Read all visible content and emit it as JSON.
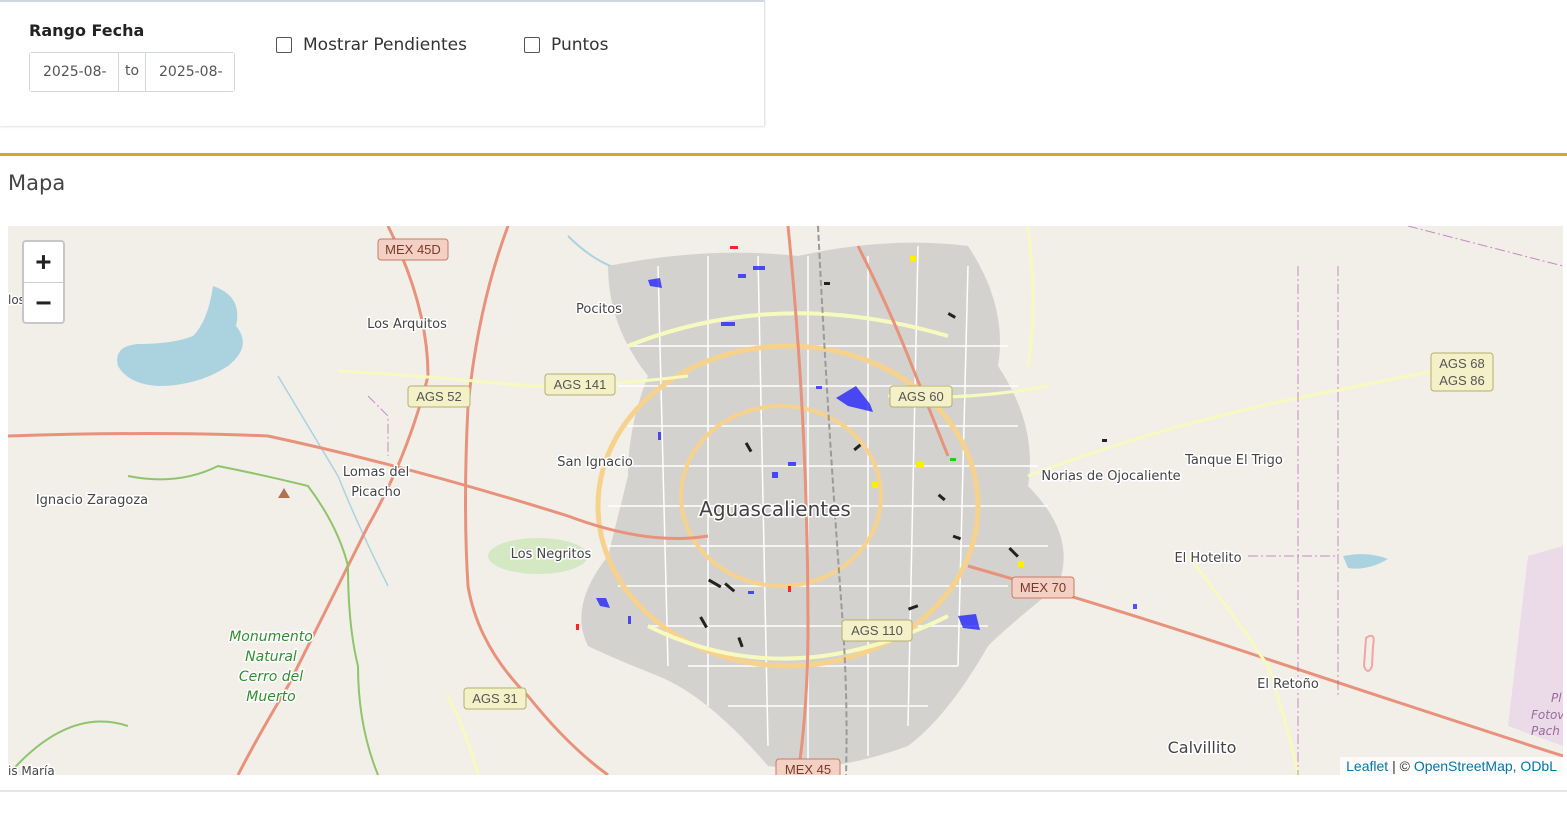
{
  "filters": {
    "range_label": "Rango Fecha",
    "start_date": "2025-08-",
    "separator": "to",
    "end_date": "2025-08-",
    "show_pending_label": "Mostrar Pendientes",
    "show_pending_checked": false,
    "points_label": "Puntos",
    "points_checked": false
  },
  "map_section": {
    "title": "Mapa",
    "accent_color": "#e0a12b",
    "zoom_in_label": "+",
    "zoom_out_label": "−",
    "attribution": {
      "leaflet": "Leaflet",
      "separator": "| ©",
      "osm": "OpenStreetMap, ODbL"
    }
  },
  "map_labels": {
    "city": "Aguascalientes",
    "pocitos": "Pocitos",
    "los_arquitos": "Los Arquitos",
    "san_ignacio": "San Ignacio",
    "lomas_del_picacho_1": "Lomas del",
    "lomas_del_picacho_2": "Picacho",
    "ignacio_zaragoza": "Ignacio Zaragoza",
    "los_negritos": "Los Negritos",
    "monumento_1": "Monumento",
    "monumento_2": "Natural",
    "monumento_3": "Cerro del",
    "monumento_4": "Muerto",
    "norias": "Norias de Ojocaliente",
    "tanque_el_trigo": "Tanque El Trigo",
    "el_hotelito": "El Hotelito",
    "el_retono": "El Retoño",
    "calvillito": "Calvillito",
    "los_edge": "los",
    "santa_maria_edge": "is María",
    "right_edge_1": "Pl",
    "right_edge_2": "Fotov",
    "right_edge_3": "Pach"
  },
  "road_shields": {
    "mex45d": "MEX 45D",
    "ags52": "AGS 52",
    "ags141": "AGS 141",
    "ags60": "AGS 60",
    "ags68": "AGS 68",
    "ags86": "AGS 86",
    "mex70": "MEX 70",
    "ags110": "AGS 110",
    "ags31": "AGS 31",
    "mex45": "MEX 45"
  },
  "overlay_colors": {
    "polygon_blue": "#1a1aff",
    "pending_black": "#222222",
    "alert_red": "#ff2222",
    "green": "#22cc22",
    "yellow": "#ffee00"
  }
}
